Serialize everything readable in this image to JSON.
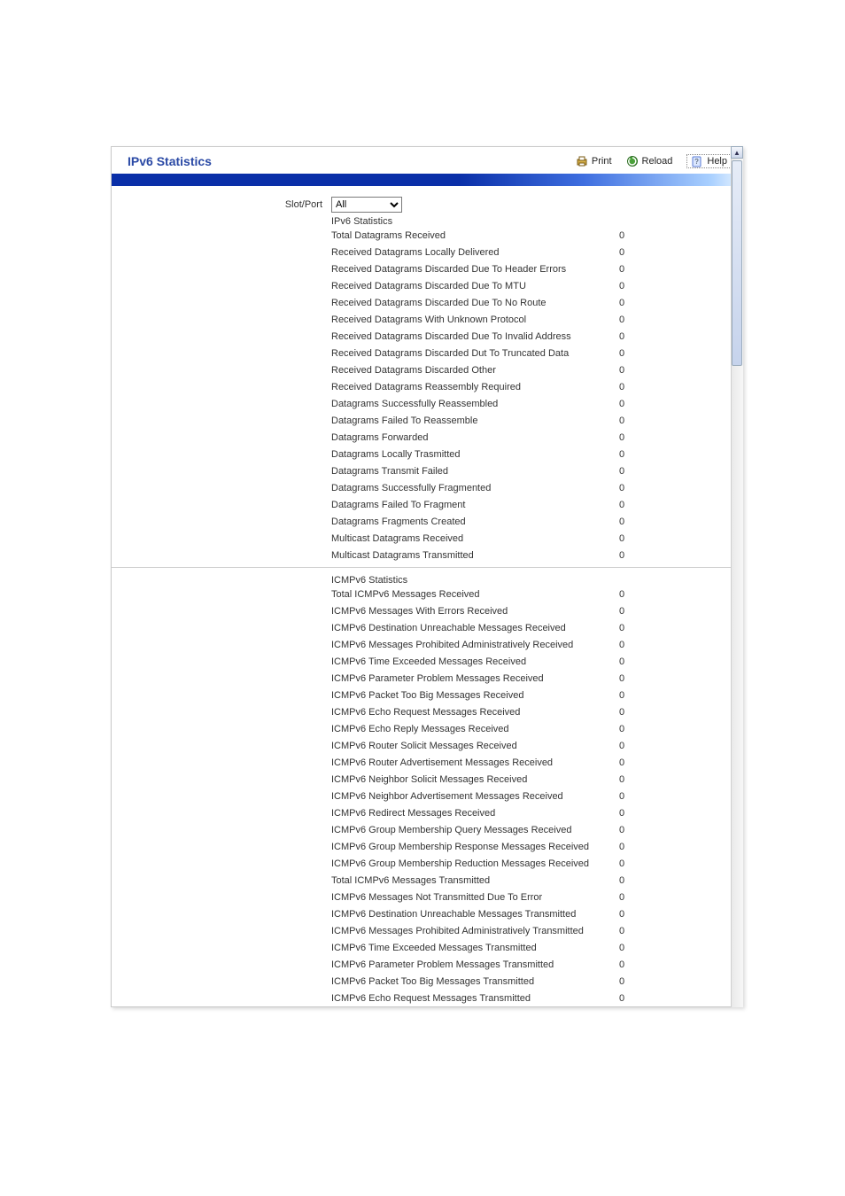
{
  "header": {
    "title": "IPv6 Statistics",
    "print": "Print",
    "reload": "Reload",
    "help": "Help"
  },
  "form": {
    "slot_port_label": "Slot/Port",
    "slot_port_value": "All"
  },
  "section1_title": "IPv6 Statistics",
  "section1_rows": [
    {
      "label": "Total Datagrams Received",
      "value": "0"
    },
    {
      "label": "Received Datagrams Locally Delivered",
      "value": "0"
    },
    {
      "label": "Received Datagrams Discarded Due To Header Errors",
      "value": "0"
    },
    {
      "label": "Received Datagrams Discarded Due To MTU",
      "value": "0"
    },
    {
      "label": "Received Datagrams Discarded Due To No Route",
      "value": "0"
    },
    {
      "label": "Received Datagrams With Unknown Protocol",
      "value": "0"
    },
    {
      "label": "Received Datagrams Discarded Due To Invalid Address",
      "value": "0"
    },
    {
      "label": "Received Datagrams Discarded Dut To Truncated Data",
      "value": "0"
    },
    {
      "label": "Received Datagrams Discarded Other",
      "value": "0"
    },
    {
      "label": "Received Datagrams Reassembly Required",
      "value": "0"
    },
    {
      "label": "Datagrams Successfully Reassembled",
      "value": "0"
    },
    {
      "label": "Datagrams Failed To Reassemble",
      "value": "0"
    },
    {
      "label": "Datagrams Forwarded",
      "value": "0"
    },
    {
      "label": "Datagrams Locally Trasmitted",
      "value": "0"
    },
    {
      "label": "Datagrams Transmit Failed",
      "value": "0"
    },
    {
      "label": "Datagrams Successfully Fragmented",
      "value": "0"
    },
    {
      "label": "Datagrams Failed To Fragment",
      "value": "0"
    },
    {
      "label": "Datagrams Fragments Created",
      "value": "0"
    },
    {
      "label": "Multicast Datagrams Received",
      "value": "0"
    },
    {
      "label": "Multicast Datagrams Transmitted",
      "value": "0"
    }
  ],
  "section2_title": "ICMPv6 Statistics",
  "section2_rows": [
    {
      "label": "Total ICMPv6 Messages Received",
      "value": "0"
    },
    {
      "label": "ICMPv6 Messages With Errors Received",
      "value": "0"
    },
    {
      "label": "ICMPv6 Destination Unreachable Messages Received",
      "value": "0"
    },
    {
      "label": "ICMPv6 Messages Prohibited Administratively Received",
      "value": "0"
    },
    {
      "label": "ICMPv6 Time Exceeded Messages Received",
      "value": "0"
    },
    {
      "label": "ICMPv6 Parameter Problem Messages Received",
      "value": "0"
    },
    {
      "label": "ICMPv6 Packet Too Big Messages Received",
      "value": "0"
    },
    {
      "label": "ICMPv6 Echo Request Messages Received",
      "value": "0"
    },
    {
      "label": "ICMPv6 Echo Reply Messages Received",
      "value": "0"
    },
    {
      "label": "ICMPv6 Router Solicit Messages Received",
      "value": "0"
    },
    {
      "label": "ICMPv6 Router Advertisement Messages Received",
      "value": "0"
    },
    {
      "label": "ICMPv6 Neighbor Solicit Messages Received",
      "value": "0"
    },
    {
      "label": "ICMPv6 Neighbor Advertisement Messages Received",
      "value": "0"
    },
    {
      "label": "ICMPv6 Redirect Messages Received",
      "value": "0"
    },
    {
      "label": "ICMPv6 Group Membership Query Messages Received",
      "value": "0"
    },
    {
      "label": "ICMPv6 Group Membership Response Messages Received",
      "value": "0"
    },
    {
      "label": "ICMPv6 Group Membership Reduction Messages Received",
      "value": "0"
    },
    {
      "label": "Total ICMPv6 Messages Transmitted",
      "value": "0"
    },
    {
      "label": "ICMPv6 Messages Not Transmitted Due To Error",
      "value": "0"
    },
    {
      "label": "ICMPv6 Destination Unreachable Messages Transmitted",
      "value": "0"
    },
    {
      "label": "ICMPv6 Messages Prohibited Administratively Transmitted",
      "value": "0"
    },
    {
      "label": "ICMPv6 Time Exceeded Messages Transmitted",
      "value": "0"
    },
    {
      "label": "ICMPv6 Parameter Problem Messages Transmitted",
      "value": "0"
    },
    {
      "label": "ICMPv6 Packet Too Big Messages Transmitted",
      "value": "0"
    },
    {
      "label": "ICMPv6 Echo Request Messages Transmitted",
      "value": "0"
    }
  ]
}
